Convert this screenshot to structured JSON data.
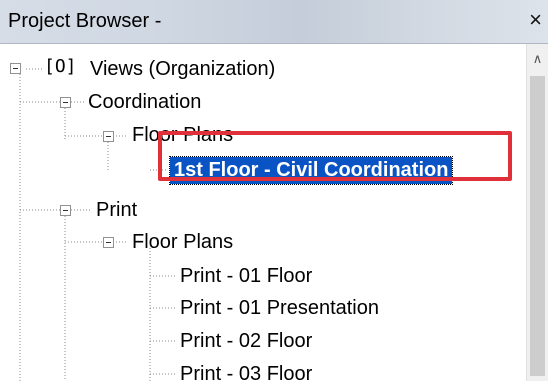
{
  "window": {
    "title": "Project Browser -",
    "close_glyph": "×"
  },
  "tree": {
    "root": {
      "icon": "views-icon",
      "icon_glyph": "[O]",
      "label": "Views (Organization)"
    },
    "coordination": {
      "label": "Coordination"
    },
    "coord_floor_plans": {
      "label": "Floor Plans"
    },
    "selected_item": {
      "label": "1st Floor - Civil Coordination"
    },
    "print": {
      "label": "Print"
    },
    "print_floor_plans": {
      "label": "Floor Plans"
    },
    "print_items": [
      {
        "label": "Print - 01 Floor"
      },
      {
        "label": "Print - 01 Presentation"
      },
      {
        "label": "Print - 02 Floor"
      },
      {
        "label": "Print - 03 Floor"
      }
    ]
  },
  "colors": {
    "selection": "#0a53c4",
    "callout_border": "#e0313a"
  }
}
